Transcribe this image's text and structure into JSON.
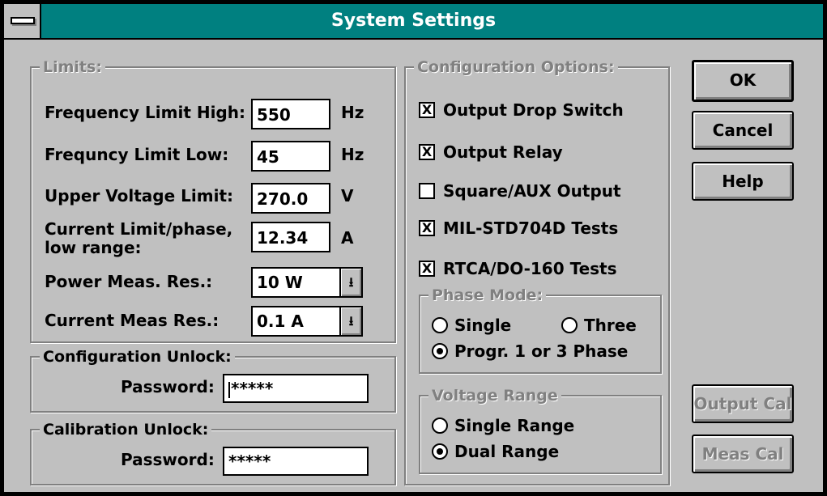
{
  "window": {
    "title": "System Settings"
  },
  "limits": {
    "legend": "Limits:",
    "freq_high_label": "Frequency Limit High:",
    "freq_high_value": "550",
    "freq_high_unit": "Hz",
    "freq_low_label": "Frequncy Limit Low:",
    "freq_low_value": "45",
    "freq_low_unit": "Hz",
    "upper_voltage_label": "Upper Voltage Limit:",
    "upper_voltage_value": "270.0",
    "upper_voltage_unit": "V",
    "current_limit_label_line1": "Current Limit/phase,",
    "current_limit_label_line2": "low range:",
    "current_limit_value": "12.34",
    "current_limit_unit": "A",
    "power_res_label": "Power Meas. Res.:",
    "power_res_value": "10 W",
    "current_res_label": "Current Meas Res.:",
    "current_res_value": "0.1 A"
  },
  "config_unlock": {
    "legend": "Configuration Unlock:",
    "password_label": "Password:",
    "password_value": "*****"
  },
  "cal_unlock": {
    "legend": "Calibration Unlock:",
    "password_label": "Password:",
    "password_value": "*****"
  },
  "config_options": {
    "legend": "Configuration Options:",
    "items": [
      {
        "label": "Output Drop Switch",
        "checked": true
      },
      {
        "label": "Output Relay",
        "checked": true
      },
      {
        "label": "Square/AUX Output",
        "checked": false
      },
      {
        "label": "MIL-STD704D Tests",
        "checked": true
      },
      {
        "label": "RTCA/DO-160 Tests",
        "checked": true
      }
    ]
  },
  "phase_mode": {
    "legend": "Phase Mode:",
    "single": "Single",
    "three": "Three",
    "progr": "Progr. 1 or 3 Phase",
    "selected": "progr"
  },
  "voltage_range": {
    "legend": "Voltage Range",
    "single": "Single Range",
    "dual": "Dual Range",
    "selected": "dual"
  },
  "buttons": {
    "ok": "OK",
    "cancel": "Cancel",
    "help": "Help",
    "output_cal": "Output Cal",
    "meas_cal": "Meas Cal"
  },
  "check_mark": "X",
  "combo_arrow": "⭳"
}
